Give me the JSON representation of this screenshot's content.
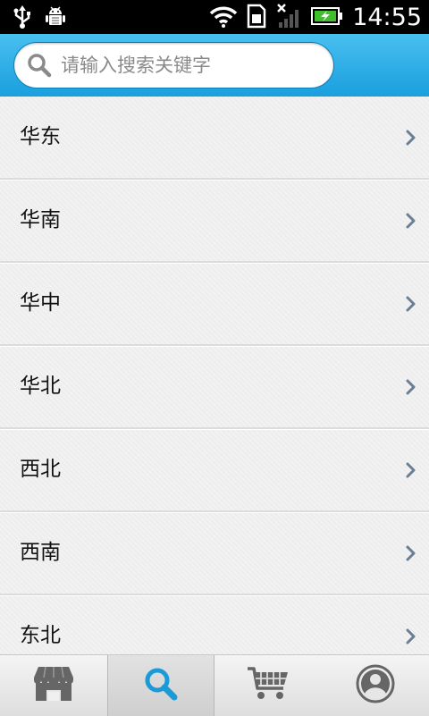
{
  "status_bar": {
    "time": "14:55",
    "icons": [
      "usb-icon",
      "android-debug-icon",
      "wifi-icon",
      "sim-card-icon",
      "signal-icon",
      "battery-charging-icon"
    ]
  },
  "search": {
    "placeholder": "请输入搜索关键字",
    "value": ""
  },
  "regions": [
    {
      "label": "华东"
    },
    {
      "label": "华南"
    },
    {
      "label": "华中"
    },
    {
      "label": "华北"
    },
    {
      "label": "西北"
    },
    {
      "label": "西南"
    },
    {
      "label": "东北"
    }
  ],
  "bottom_nav": {
    "tabs": [
      {
        "icon": "store-icon",
        "active": false
      },
      {
        "icon": "search-icon",
        "active": true
      },
      {
        "icon": "cart-icon",
        "active": false
      },
      {
        "icon": "profile-icon",
        "active": false
      }
    ]
  },
  "colors": {
    "header_gradient_top": "#49bff0",
    "header_gradient_bottom": "#1a9fde",
    "active_icon": "#1a9bd8",
    "inactive_icon": "#666666",
    "chevron": "#6a7f95"
  }
}
